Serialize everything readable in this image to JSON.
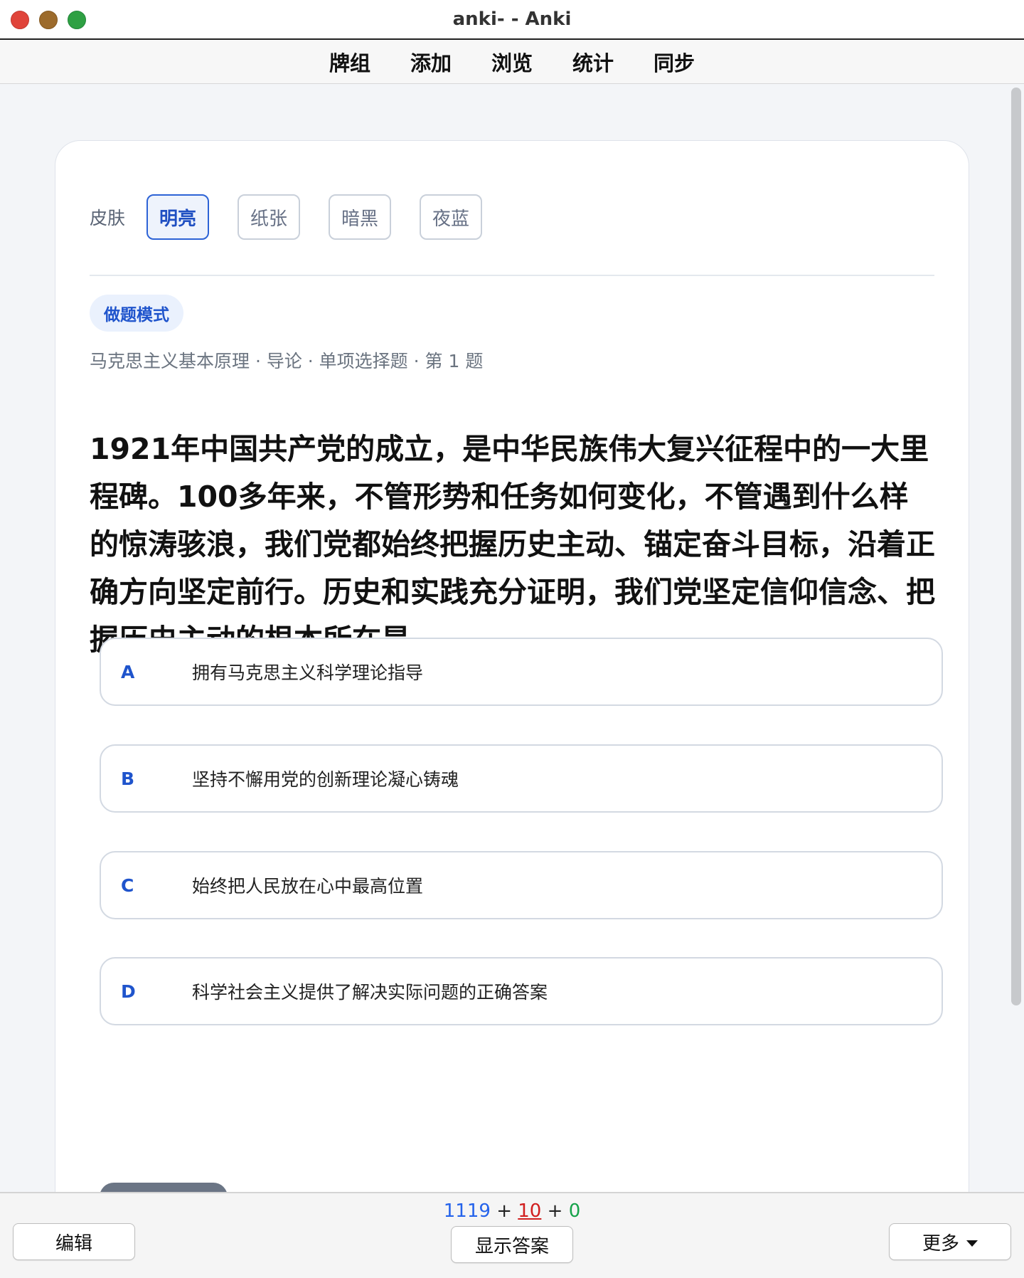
{
  "window": {
    "title": "anki- - Anki"
  },
  "menu": {
    "items": [
      "牌组",
      "添加",
      "浏览",
      "统计",
      "同步"
    ]
  },
  "skins": {
    "label": "皮肤",
    "options": [
      "明亮",
      "纸张",
      "暗黑",
      "夜蓝"
    ],
    "active": "明亮"
  },
  "mode_badge": "做题模式",
  "breadcrumb": "马克思主义基本原理 · 导论 · 单项选择题 · 第 1 题",
  "question": "1921年中国共产党的成立，是中华民族伟大复兴征程中的一大里程碑。100多年来，不管形势和任务如何变化，不管遇到什么样的惊涛骇浪，我们党都始终把握历史主动、锚定奋斗目标，沿着正确方向坚定前行。历史和实践充分证明，我们党坚定信仰信念、把握历史主动的根本所在是",
  "options": [
    {
      "letter": "A",
      "text": "拥有马克思主义科学理论指导"
    },
    {
      "letter": "B",
      "text": "坚持不懈用党的创新理论凝心铸魂"
    },
    {
      "letter": "C",
      "text": "始终把人民放在心中最高位置"
    },
    {
      "letter": "D",
      "text": "科学社会主义提供了解决实际问题的正确答案"
    }
  ],
  "counts": {
    "new": "1119",
    "learn": "10",
    "review": "0",
    "sep": "+"
  },
  "bottom": {
    "edit_label": "编辑",
    "show_answer_label": "显示答案",
    "more_label": "更多"
  },
  "colors": {
    "accent": "#2d63d6",
    "new_count": "#2563eb",
    "learn_count": "#d11f1f",
    "review_count": "#16a34a"
  },
  "icons": [
    "close-button",
    "minimize-button",
    "zoom-button",
    "caret-down-icon"
  ]
}
